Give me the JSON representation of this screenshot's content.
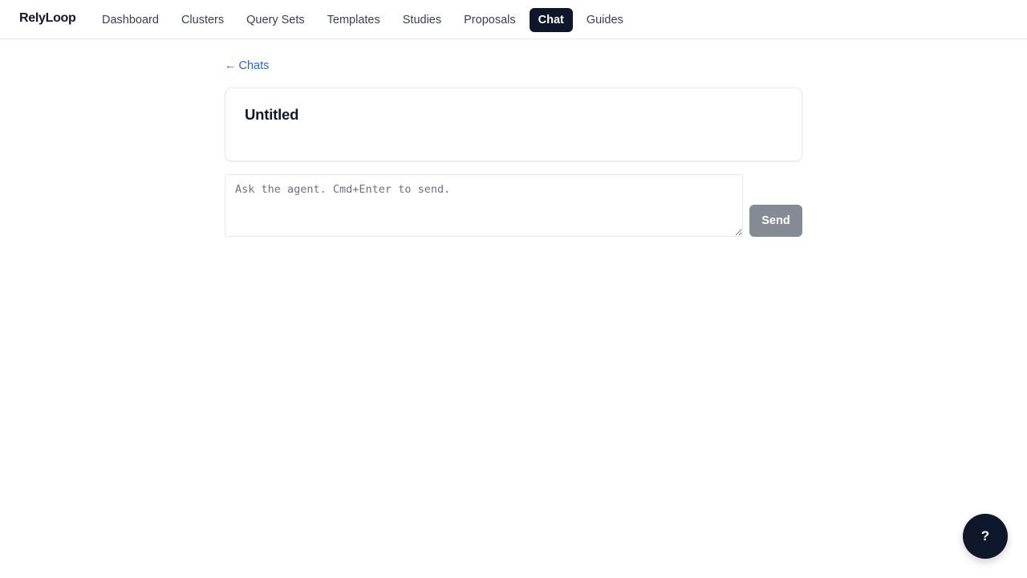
{
  "app": {
    "brand": "RelyLoop"
  },
  "nav": {
    "items": [
      {
        "label": "Dashboard",
        "active": false
      },
      {
        "label": "Clusters",
        "active": false
      },
      {
        "label": "Query Sets",
        "active": false
      },
      {
        "label": "Templates",
        "active": false
      },
      {
        "label": "Studies",
        "active": false
      },
      {
        "label": "Proposals",
        "active": false
      },
      {
        "label": "Chat",
        "active": true
      },
      {
        "label": "Guides",
        "active": false
      }
    ]
  },
  "chat": {
    "back_arrow": "←",
    "back_label": "Chats",
    "title": "Untitled",
    "input_value": "",
    "input_placeholder": "Ask the agent. Cmd+Enter to send.",
    "send_label": "Send"
  },
  "help": {
    "label": "?"
  },
  "colors": {
    "accent_link": "#2563eb",
    "nav_active_bg": "#0f172a",
    "send_disabled_bg": "#858b95",
    "help_bg": "#0f172a"
  }
}
